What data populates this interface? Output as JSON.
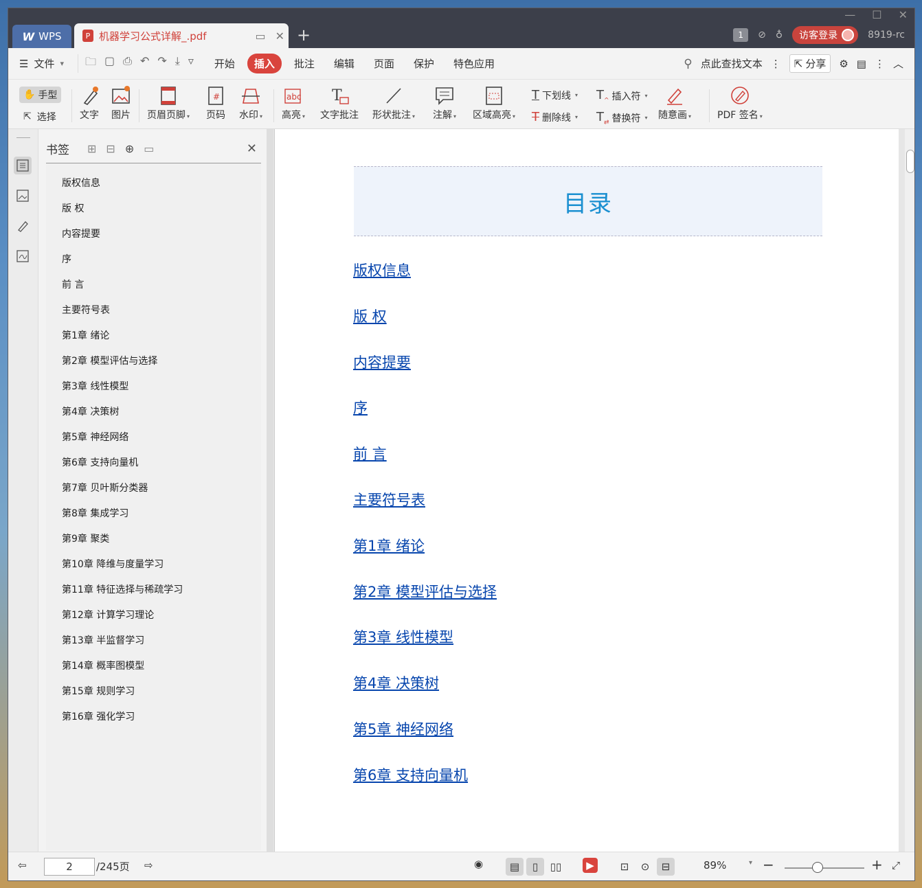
{
  "titlebar": {
    "wps_tab": "WPS",
    "doc_tab": "机器学习公式详解_.pdf",
    "page_count_badge": "1",
    "login_button": "访客登录",
    "user_id": "8919-rc"
  },
  "menubar": {
    "file": "文件",
    "items": [
      {
        "label": "开始",
        "active": false
      },
      {
        "label": "插入",
        "active": true
      },
      {
        "label": "批注",
        "active": false
      },
      {
        "label": "编辑",
        "active": false
      },
      {
        "label": "页面",
        "active": false
      },
      {
        "label": "保护",
        "active": false
      },
      {
        "label": "特色应用",
        "active": false
      }
    ],
    "search_placeholder": "点此查找文本",
    "share": "分享"
  },
  "ribbon": {
    "hand": "手型",
    "select": "选择",
    "text": "文字",
    "image": "图片",
    "header_footer": "页眉页脚",
    "page_number": "页码",
    "watermark": "水印",
    "highlight": "高亮",
    "text_comment": "文字批注",
    "shape_comment": "形状批注",
    "annotation": "注解",
    "area_highlight": "区域高亮",
    "underline": "下划线",
    "strikethrough": "删除线",
    "insert_mark": "插入符",
    "replace_mark": "替换符",
    "freehand": "随意画",
    "pdf_sign": "PDF 签名"
  },
  "bookmarks": {
    "title": "书签",
    "items": [
      "版权信息",
      "版 权",
      "内容提要",
      "序",
      "前 言",
      "主要符号表",
      "第1章 绪论",
      "第2章 模型评估与选择",
      "第3章 线性模型",
      "第4章 决策树",
      "第5章 神经网络",
      "第6章 支持向量机",
      "第7章 贝叶斯分类器",
      "第8章 集成学习",
      "第9章 聚类",
      "第10章 降维与度量学习",
      "第11章 特征选择与稀疏学习",
      "第12章 计算学习理论",
      "第13章 半监督学习",
      "第14章 概率图模型",
      "第15章 规则学习",
      "第16章 强化学习"
    ]
  },
  "document": {
    "toc_title": "目录",
    "toc_links": [
      "版权信息",
      "版 权",
      "内容提要",
      "序",
      "前 言",
      "主要符号表",
      "第1章 绪论",
      "第2章 模型评估与选择",
      "第3章 线性模型",
      "第4章 决策树",
      "第5章 神经网络",
      "第6章 支持向量机"
    ]
  },
  "statusbar": {
    "current_page": "2",
    "total_pages": "/245页",
    "zoom": "89%"
  },
  "colors": {
    "accent": "#d9443d",
    "toc_title": "#1a8fd0",
    "link": "#0645ad",
    "titlebar": "#3c3f4a"
  }
}
